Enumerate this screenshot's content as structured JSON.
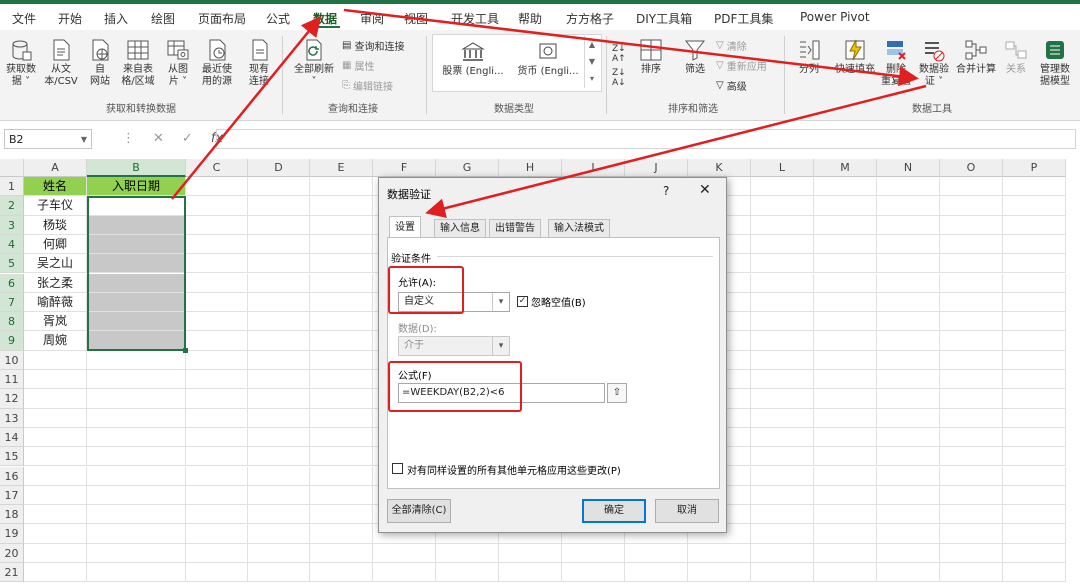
{
  "menu": {
    "items": [
      "文件",
      "开始",
      "插入",
      "绘图",
      "页面布局",
      "公式",
      "数据",
      "审阅",
      "视图",
      "开发工具",
      "帮助",
      "方方格子",
      "DIY工具箱",
      "PDF工具集",
      "Power Pivot"
    ],
    "active": "数据"
  },
  "ribbon": {
    "get_data": {
      "buttons": [
        "获取数\n据 ˅",
        "从文\n本/CSV",
        "自\n网站",
        "来自表\n格/区域",
        "从图\n片 ˅",
        "最近使\n用的源",
        "现有\n连接"
      ],
      "group_label": "获取和转换数据"
    },
    "queries": {
      "refresh_all": "全部刷新\n˅",
      "small": [
        "查询和连接",
        "属性",
        "编辑链接"
      ],
      "group_label": "查询和连接"
    },
    "data_types": {
      "stocks": "股票 (Engli...",
      "currency": "货币 (Engli...",
      "group_label": "数据类型"
    },
    "sort_filter": {
      "sort": "排序",
      "filter": "筛选",
      "small": [
        "清除",
        "重新应用",
        "高级"
      ],
      "group_label": "排序和筛选"
    },
    "data_tools": {
      "buttons": [
        "分列",
        "快速填充",
        "删除\n重复值",
        "数据验\n证 ˅",
        "合并计算",
        "关系",
        "管理数\n据模型"
      ],
      "group_label": "数据工具"
    }
  },
  "formula_bar": {
    "name_box": "B2",
    "tools": [
      "⋮",
      "✕",
      "✓",
      "fx"
    ],
    "content": ""
  },
  "sheet": {
    "columns": [
      "A",
      "B",
      "C",
      "D",
      "E",
      "F",
      "G",
      "H",
      "I",
      "J",
      "K",
      "L",
      "M",
      "N",
      "O",
      "P"
    ],
    "rows": [
      "1",
      "2",
      "3",
      "4",
      "5",
      "6",
      "7",
      "8",
      "9",
      "10",
      "11",
      "12",
      "13",
      "14",
      "15",
      "16",
      "17",
      "18",
      "19",
      "20",
      "21"
    ],
    "header_row": [
      "姓名",
      "入职日期"
    ],
    "names": [
      "子车仪",
      "杨琰",
      "何卿",
      "吴之山",
      "张之柔",
      "喻醉薇",
      "胥岚",
      "周婉"
    ]
  },
  "dialog": {
    "title": "数据验证",
    "help": "?",
    "close": "✕",
    "tabs": [
      "设置",
      "输入信息",
      "出错警告",
      "输入法模式"
    ],
    "section": "验证条件",
    "allow_label": "允许(A):",
    "allow_value": "自定义",
    "ignore_blank": "忽略空值(B)",
    "data_label": "数据(D):",
    "data_value": "介于",
    "formula_label": "公式(F)",
    "formula_value": "=WEEKDAY(B2,2)<6",
    "apply_all": "对有同样设置的所有其他单元格应用这些更改(P)",
    "clear_all": "全部清除(C)",
    "ok": "确定",
    "cancel": "取消"
  },
  "colors": {
    "excel_green": "#217346",
    "header_fill": "#92d050",
    "shade_fill": "#c8c8c8",
    "annotation_red": "#e02020"
  }
}
